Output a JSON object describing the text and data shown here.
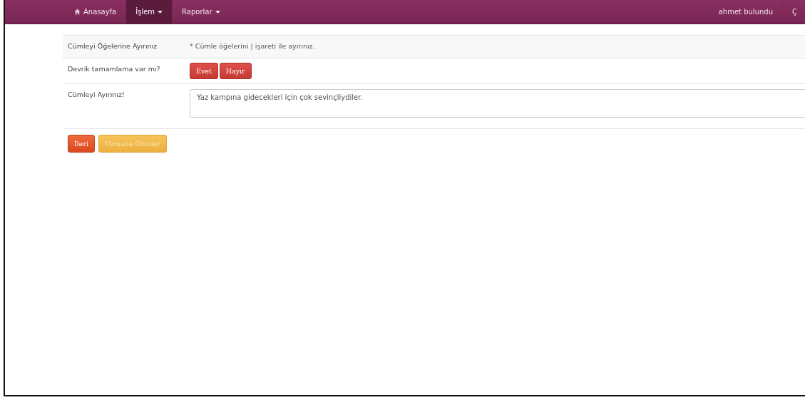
{
  "nav": {
    "items": [
      {
        "label": "Anasayfa",
        "kind": "home",
        "selected": false
      },
      {
        "label": "İşlem",
        "kind": "dropdown",
        "selected": true
      },
      {
        "label": "Raporlar",
        "kind": "dropdown",
        "selected": false
      }
    ],
    "right": [
      {
        "label": "ahmet bulundu"
      },
      {
        "label": "Ç"
      }
    ]
  },
  "form": {
    "rows": [
      {
        "kind": "text",
        "label": "Cümleyi Öğelerine Ayırınız",
        "value": "* Cümle öğelerini | işareti ile ayırınız."
      },
      {
        "kind": "buttons",
        "label": "Devrik tamamlama var mı?",
        "buttons": [
          "Evet",
          "Hayır"
        ]
      },
      {
        "kind": "textarea",
        "label": "Cümleyi Ayırınız!",
        "value": "Yaz kampına gidecekleri için çok sevinçliydiler."
      }
    ]
  },
  "actions": [
    {
      "label": "İleri",
      "kind": "danger",
      "disabled": false
    },
    {
      "label": "Uzmana Gönder",
      "kind": "warning",
      "disabled": true
    }
  ]
}
